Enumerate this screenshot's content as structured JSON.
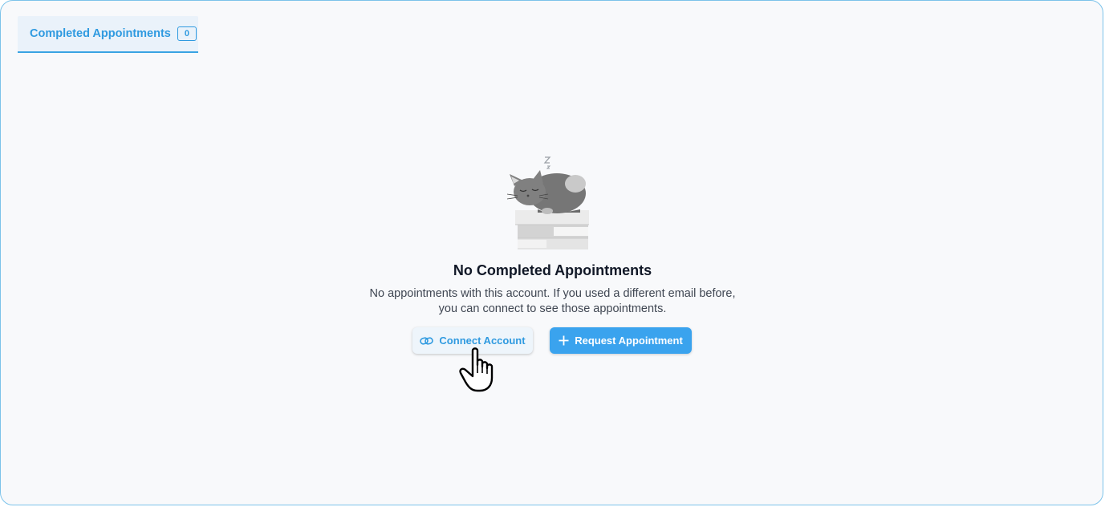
{
  "tabs": [
    {
      "label": "Completed Appointments",
      "count": "0",
      "active": true
    }
  ],
  "empty_state": {
    "illustration": "sleeping-cat-on-books",
    "title": "No Completed Appointments",
    "description_line1": "No appointments with this account. If you used a different email before,",
    "description_line2": "you can connect to see those appointments."
  },
  "actions": {
    "connect": {
      "label": "Connect Account",
      "icon": "link-icon"
    },
    "request": {
      "label": "Request Appointment",
      "icon": "plus-icon"
    }
  },
  "colors": {
    "accent": "#2f9ae0",
    "primary_button": "#3aa3ee",
    "frame_border": "#7cc3ea",
    "background": "#f8f9fb"
  }
}
